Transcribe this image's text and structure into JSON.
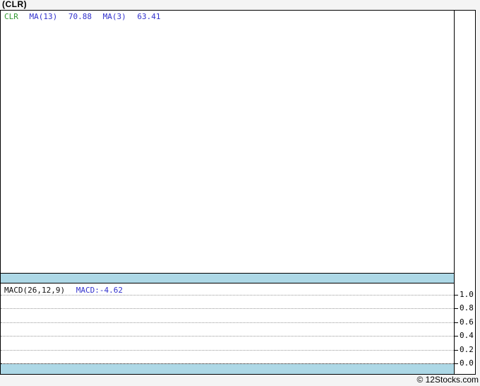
{
  "page": {
    "title": "(CLR)",
    "footer": "© 12Stocks.com"
  },
  "price_panel": {
    "legend": {
      "symbol": "CLR",
      "ma13_label": "MA(13)",
      "ma13_value": "70.88",
      "ma3_label": "MA(3)",
      "ma3_value": "63.41"
    }
  },
  "macd_panel": {
    "legend": {
      "label": "MACD(26,12,9)",
      "value": "MACD:-4.62"
    },
    "axis_ticks": [
      "1.0",
      "0.8",
      "0.6",
      "0.4",
      "0.2",
      "0.0"
    ]
  },
  "colors": {
    "symbol_green": "#339933",
    "ma_blue": "#3232cd",
    "band_lightblue": "#add8e6",
    "page_background": "#f4f4f4",
    "gridline_gray": "#999999"
  },
  "chart_data": [
    {
      "type": "line",
      "panel": "price",
      "title": "(CLR)",
      "series": [
        {
          "name": "CLR",
          "values": []
        },
        {
          "name": "MA(13)",
          "last_value": 70.88,
          "values": []
        },
        {
          "name": "MA(3)",
          "last_value": 63.41,
          "values": []
        }
      ],
      "legend_position": "top-left",
      "grid": false,
      "note": "price panel area is rendered blank; only legend values are visible"
    },
    {
      "type": "line",
      "panel": "indicator",
      "title": "MACD(26,12,9)",
      "series": [
        {
          "name": "MACD",
          "last_value": -4.62,
          "values": []
        }
      ],
      "ylim": [
        0.0,
        1.0
      ],
      "yticks": [
        1.0,
        0.8,
        0.6,
        0.4,
        0.2,
        0.0
      ],
      "legend_position": "top-left",
      "grid": true,
      "note": "indicator panel area is rendered blank; only dotted gridlines and right axis labels are visible"
    }
  ]
}
